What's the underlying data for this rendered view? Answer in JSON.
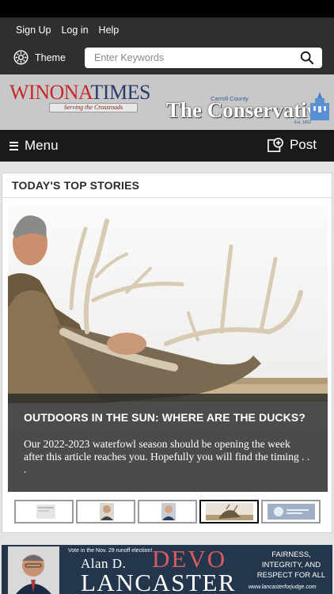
{
  "top_bar": {
    "links": [
      "Sign Up",
      "Log in",
      "Help"
    ],
    "theme_label": "Theme",
    "search_placeholder": "Enter Keywords"
  },
  "banner": {
    "winona_part1": "WINONA",
    "winona_part2": "TIMES",
    "winona_tagline": "Serving the Crossroads",
    "carroll_county": "Carroll County",
    "conservative": "The Conservative",
    "est": "Est. 1862"
  },
  "nav": {
    "menu_label": "Menu",
    "post_label": "Post"
  },
  "top_stories": {
    "title": "TODAY'S TOP STORIES",
    "headline": "OUTDOORS IN THE SUN: WHERE ARE THE DUCKS?",
    "teaser": "Our 2022-2023 waterfowl season should be opening the week after this article reaches you. Hopefully you will find the timing . . .",
    "active_thumb": 4
  },
  "ad": {
    "vote": "Vote in the Nov. 29 runoff election!",
    "name": "Alan D.",
    "devo": "DEVO",
    "lancaster": "LANCASTER",
    "fair_1": "FAIRNESS,",
    "fair_2": "INTEGRITY, AND",
    "fair_3": "RESPECT FOR ALL",
    "url": "www.lancasterforjudge.com"
  },
  "colors": {
    "brand_red": "#c6282b",
    "brand_blue": "#2a3b6b",
    "ad_bg": "#24364b",
    "devo_red": "#d85b62"
  }
}
